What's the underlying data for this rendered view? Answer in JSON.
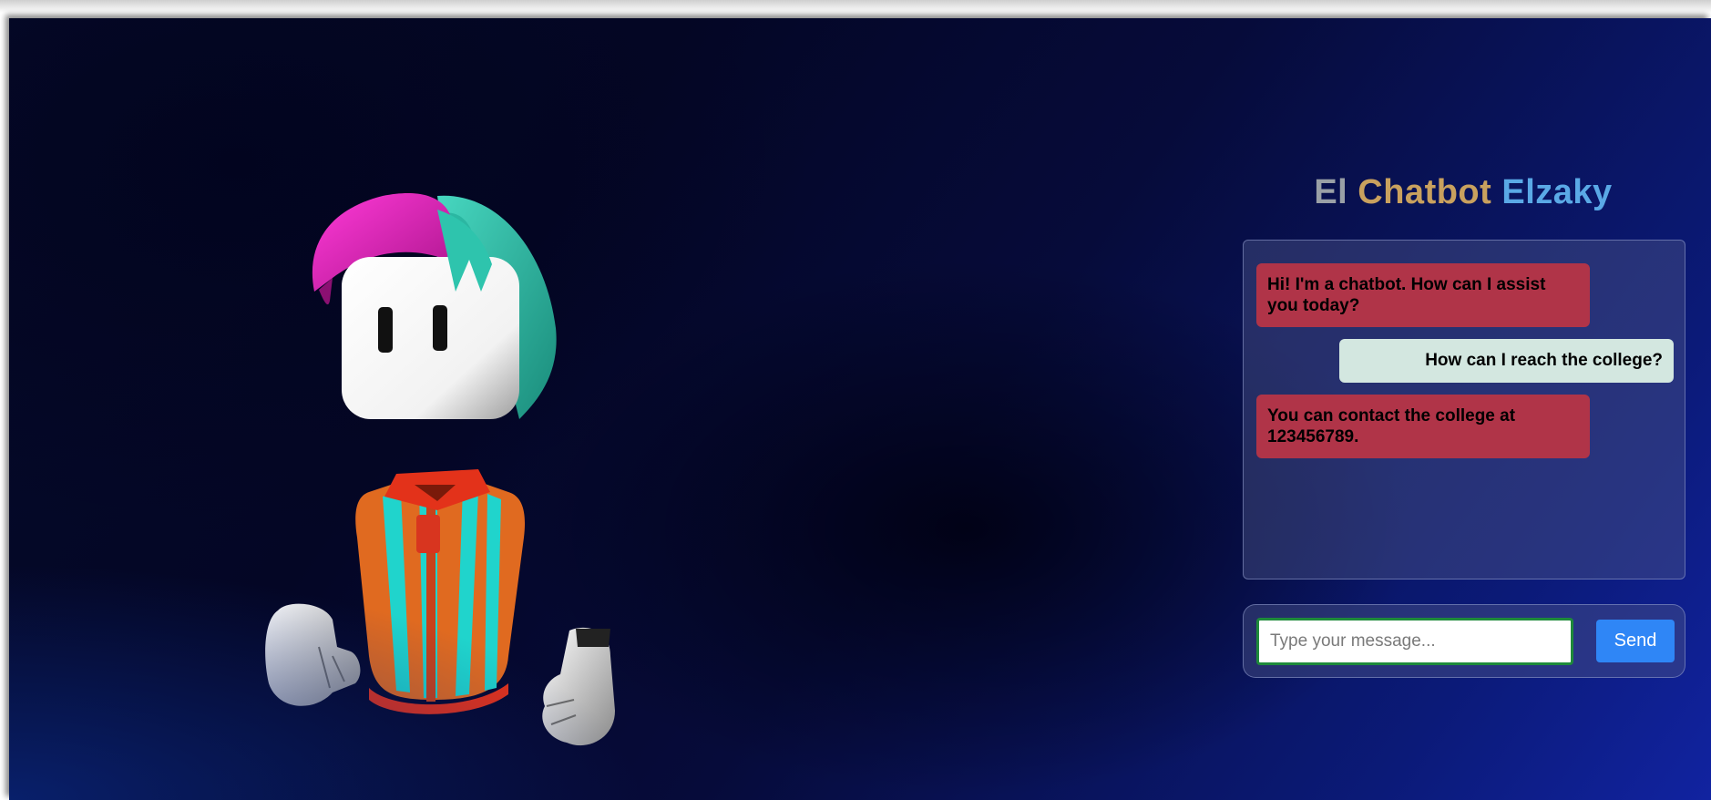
{
  "app": {
    "title_words": [
      "El",
      "Chatbot",
      "Elzaky"
    ],
    "colors": {
      "title_word_1": "#9aa0a6",
      "title_word_2": "#c9a15e",
      "title_word_3": "#5aa9e6",
      "bot_bubble": "#b03448",
      "user_bubble": "#d3e7e0",
      "send_button": "#2f86f6",
      "input_border": "#1e8a3a"
    }
  },
  "avatar": {
    "icon": "robot-avatar-3d"
  },
  "chat": {
    "messages": [
      {
        "sender": "bot",
        "text": "Hi! I'm a chatbot. How can I assist you today?"
      },
      {
        "sender": "user",
        "text": "How can I reach the college?"
      },
      {
        "sender": "bot",
        "text": "You can contact the college at 123456789."
      }
    ]
  },
  "composer": {
    "placeholder": "Type your message...",
    "value": "",
    "send_label": "Send"
  }
}
